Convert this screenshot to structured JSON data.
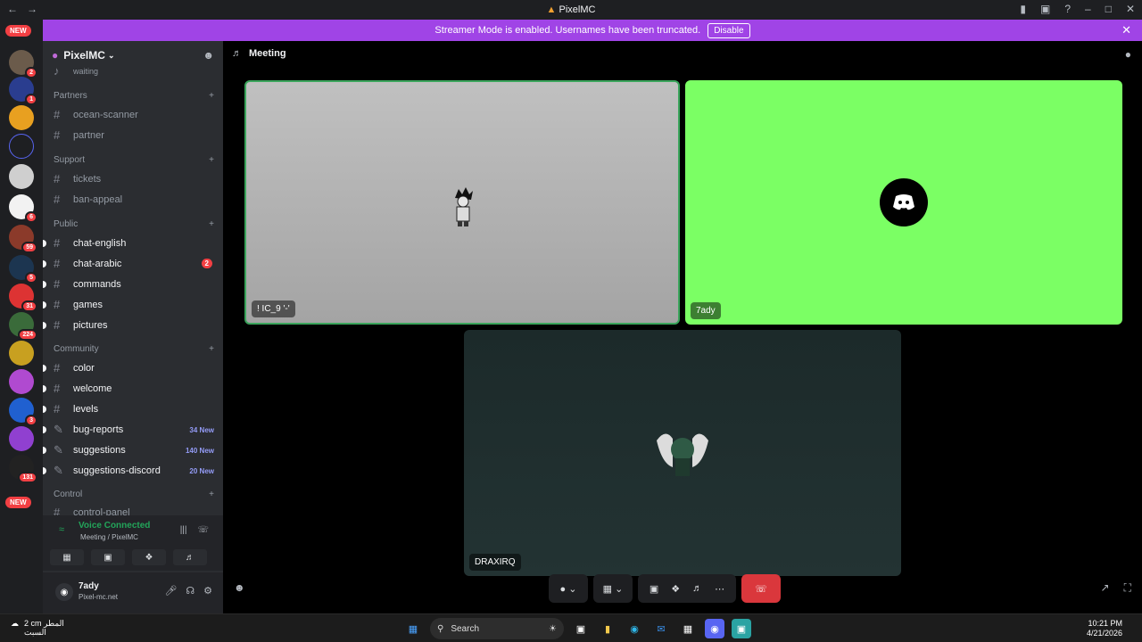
{
  "window": {
    "title": "PixelMC",
    "back": "←",
    "forward": "→"
  },
  "streamer_banner": {
    "text": "Streamer Mode is enabled. Usernames have been truncated.",
    "disable_label": "Disable"
  },
  "guild_rail": {
    "new_top": "NEW",
    "new_bottom": "NEW",
    "badges": [
      "2",
      "1",
      "6",
      "59",
      "5",
      "31",
      "224",
      "3",
      "131"
    ]
  },
  "server": {
    "name": "PixelMC",
    "partial_top": "waiting"
  },
  "categories": [
    {
      "name": "Partners",
      "channels": [
        "ocean-scanner",
        "partner"
      ]
    },
    {
      "name": "Support",
      "channels": [
        "tickets",
        "ban-appeal"
      ]
    },
    {
      "name": "Public",
      "channels": [
        "chat-english",
        "chat-arabic",
        "commands",
        "games",
        "pictures"
      ]
    },
    {
      "name": "Community",
      "channels": [
        "color",
        "welcome",
        "levels",
        "bug-reports",
        "suggestions",
        "suggestions-discord"
      ]
    },
    {
      "name": "Control",
      "channels": [
        "control-panel"
      ]
    }
  ],
  "channel_badges": {
    "chat_arabic": "2",
    "bug_reports": "34 New",
    "suggestions": "140 New",
    "suggestions_discord": "20 New"
  },
  "voice": {
    "status": "Voice Connected",
    "location": "Meeting / PixelMC"
  },
  "user": {
    "name": "7ady",
    "status": "Pixel-mc.net"
  },
  "stage": {
    "channel": "Meeting"
  },
  "participants": [
    {
      "label": "! IC_9 '-'"
    },
    {
      "label": "7ady"
    },
    {
      "label": "DRAXIRQ"
    }
  ],
  "taskbar": {
    "weather_temp": "2 cm المطر",
    "weather_day": "السبت",
    "search": "Search",
    "time": "10:21 PM",
    "date": "4/21/2026"
  },
  "colors": {
    "accent": "#a044e6",
    "green": "#23a55a",
    "danger": "#da373c",
    "tile_green": "#7bff64"
  }
}
